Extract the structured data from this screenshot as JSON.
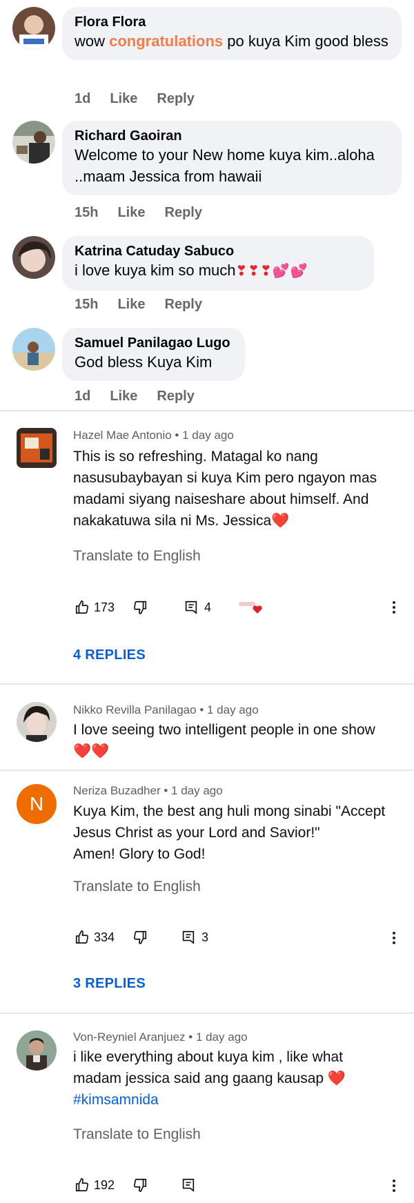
{
  "fb_comments": [
    {
      "name": "Flora Flora",
      "text_pre": "wow ",
      "text_hl": "congratulations",
      "text_post": " po kuya Kim good bless",
      "time": "1d",
      "like": "Like",
      "reply": "Reply"
    },
    {
      "name": "Richard Gaoiran",
      "text": "Welcome to your New home kuya kim..aloha ..maam Jessica from hawaii",
      "time": "15h",
      "like": "Like",
      "reply": "Reply"
    },
    {
      "name": "Katrina Catuday Sabuco",
      "text": "i love kuya kim so much",
      "emoji": "❣❣❣💕💕",
      "time": "15h",
      "like": "Like",
      "reply": "Reply"
    },
    {
      "name": "Samuel Panilagao Lugo",
      "text": "God bless Kuya Kim",
      "time": "1d",
      "like": "Like",
      "reply": "Reply"
    }
  ],
  "yt_comments": [
    {
      "author": "Hazel Mae Antonio",
      "age": "1 day ago",
      "text": "This is so refreshing. Matagal ko nang nasusubaybayan si kuya Kim pero ngayon mas madami siyang naiseshare about himself. And nakakatuwa sila ni Ms. Jessica",
      "emoji": "❤️",
      "translate": "Translate to English",
      "likes": "173",
      "replies_count": "4",
      "replies_label": "4 REPLIES"
    },
    {
      "author": "Nikko Revilla Panilagao",
      "age": "1 day ago",
      "text": "I love seeing two intelligent people in one show",
      "emoji": "❤️❤️"
    },
    {
      "author": "Neriza Buzadher",
      "age": "1 day ago",
      "avatar_letter": "N",
      "text": "Kuya Kim, the best ang huli mong sinabi \"Accept Jesus Christ as your Lord and Savior!\"",
      "text2": "Amen! Glory to God!",
      "translate": "Translate to English",
      "likes": "334",
      "replies_count": "3",
      "replies_label": "3 REPLIES"
    },
    {
      "author": "Von-Reyniel Aranjuez",
      "age": "1 day ago",
      "text": "i like everything about kuya kim , like what madam jessica said ang gaang kausap",
      "emoji": "❤️",
      "hashtag": "#kimsamnida",
      "translate": "Translate to English",
      "likes": "192"
    }
  ],
  "colors": {
    "fb_bubble": "#f0f2f5",
    "highlight": "#f07d4d",
    "link_blue": "#065fd4",
    "neriza_avatar": "#ef6c00"
  }
}
